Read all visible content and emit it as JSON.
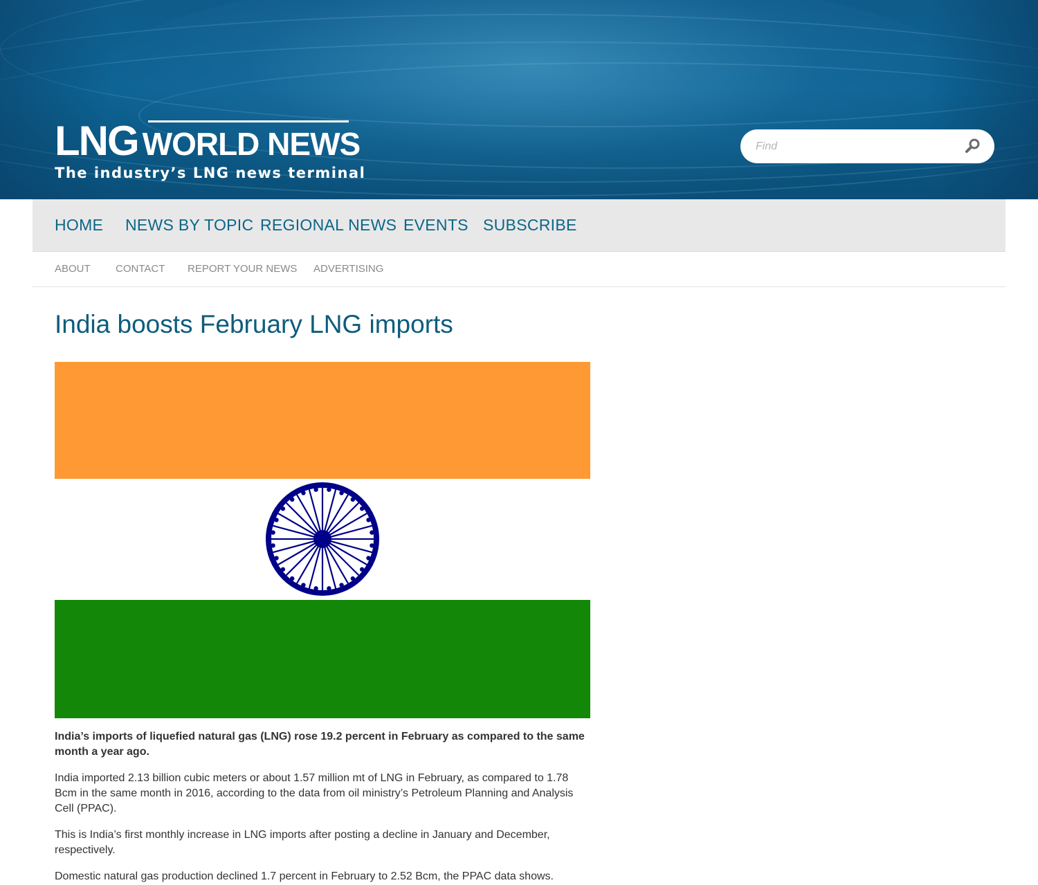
{
  "header": {
    "logo": {
      "part1": "LNG",
      "part2": "WORLD NEWS",
      "tagline": "The industry’s LNG news terminal"
    },
    "search": {
      "placeholder": "Find",
      "icon": "search-icon"
    }
  },
  "nav": {
    "primary": [
      {
        "label": "HOME"
      },
      {
        "label": "NEWS BY TOPIC"
      },
      {
        "label": "REGIONAL NEWS"
      },
      {
        "label": "EVENTS"
      },
      {
        "label": "SUBSCRIBE"
      }
    ],
    "secondary": [
      {
        "label": "ABOUT"
      },
      {
        "label": "CONTACT"
      },
      {
        "label": "REPORT YOUR NEWS"
      },
      {
        "label": "ADVERTISING"
      }
    ]
  },
  "article": {
    "title": "India boosts February LNG imports",
    "image": {
      "subject": "flag-of-india",
      "colors": {
        "saffron": "#ff9933",
        "white": "#ffffff",
        "green": "#138808",
        "chakra": "#000088"
      }
    },
    "paragraphs": [
      "India’s imports of liquefied natural gas (LNG) rose 19.2 percent in February as compared to the same month a year ago.",
      "India imported 2.13 billion cubic meters or about 1.57 million mt of LNG in February, as compared to 1.78 Bcm in the same month in 2016, according to the data from oil ministry’s Petroleum Planning and Analysis Cell (PPAC).",
      "This is India’s first monthly increase in LNG imports after posting a decline in January and December, respectively.",
      "Domestic natural gas production declined 1.7 percent in February to 2.52 Bcm, the PPAC data shows."
    ]
  },
  "colors": {
    "brand_blue": "#0e5c7d",
    "nav_link": "#0b6688",
    "header_bg": "#0d6494"
  }
}
